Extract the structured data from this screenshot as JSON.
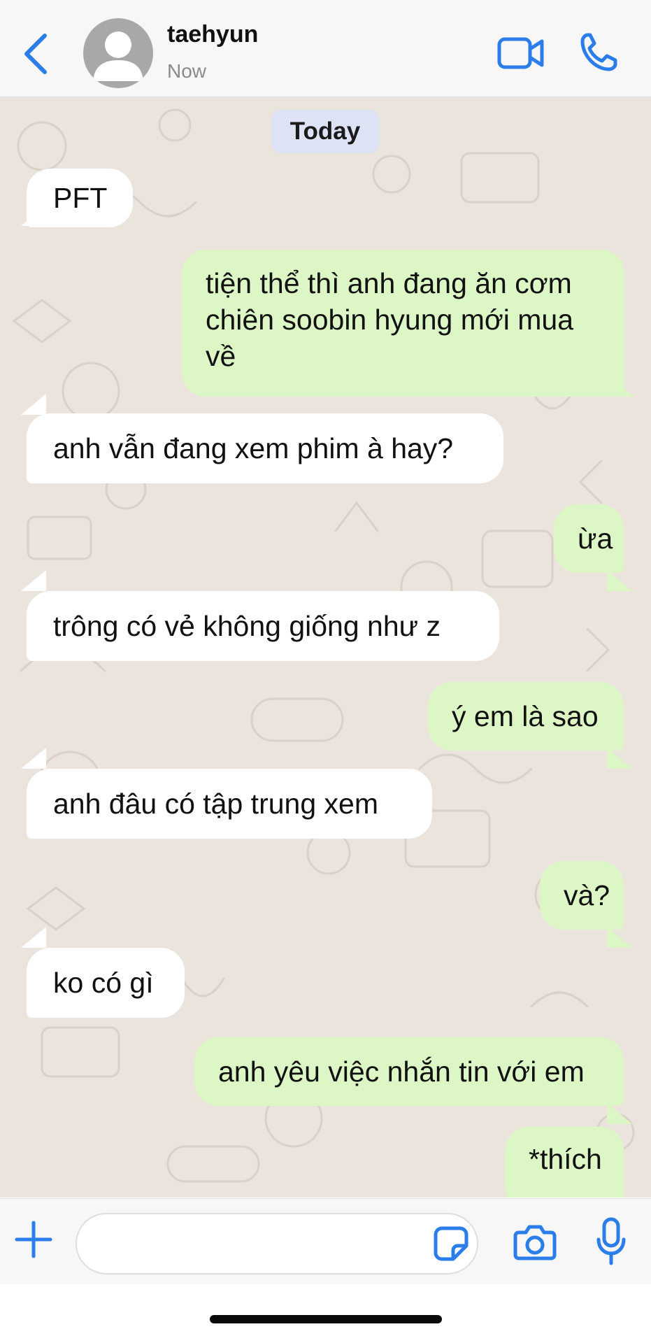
{
  "header": {
    "contact_name": "taehyun",
    "status": "Now",
    "icons": {
      "back": "chevron-left-icon",
      "avatar": "person-placeholder-icon",
      "video": "video-camera-icon",
      "call": "phone-icon"
    }
  },
  "chat": {
    "date_label": "Today",
    "messages": [
      {
        "direction": "incoming",
        "text": "PFT"
      },
      {
        "direction": "outgoing",
        "text": "tiện thể thì anh đang ăn cơm chiên soobin hyung mới mua về"
      },
      {
        "direction": "incoming",
        "text": "anh vẫn đang xem phim à hay?"
      },
      {
        "direction": "outgoing",
        "text": "ừa"
      },
      {
        "direction": "incoming",
        "text": "trông có vẻ không giống như z"
      },
      {
        "direction": "outgoing",
        "text": "ý em là sao"
      },
      {
        "direction": "incoming",
        "text": "anh đâu có tập trung xem"
      },
      {
        "direction": "outgoing",
        "text": "và?"
      },
      {
        "direction": "incoming",
        "text": "ko có gì"
      },
      {
        "direction": "outgoing",
        "text": "anh yêu việc nhắn tin với em"
      },
      {
        "direction": "outgoing",
        "text": "*thích"
      }
    ]
  },
  "composer": {
    "value": "",
    "icons": {
      "add": "plus-icon",
      "sticker": "sticker-icon",
      "camera": "camera-icon",
      "mic": "microphone-icon"
    }
  },
  "colors": {
    "accent": "#2b7de9",
    "incoming_bubble": "#ffffff",
    "outgoing_bubble": "#dcf7c5",
    "chat_background": "#ebe4dc",
    "date_pill": "#dde3f4"
  }
}
